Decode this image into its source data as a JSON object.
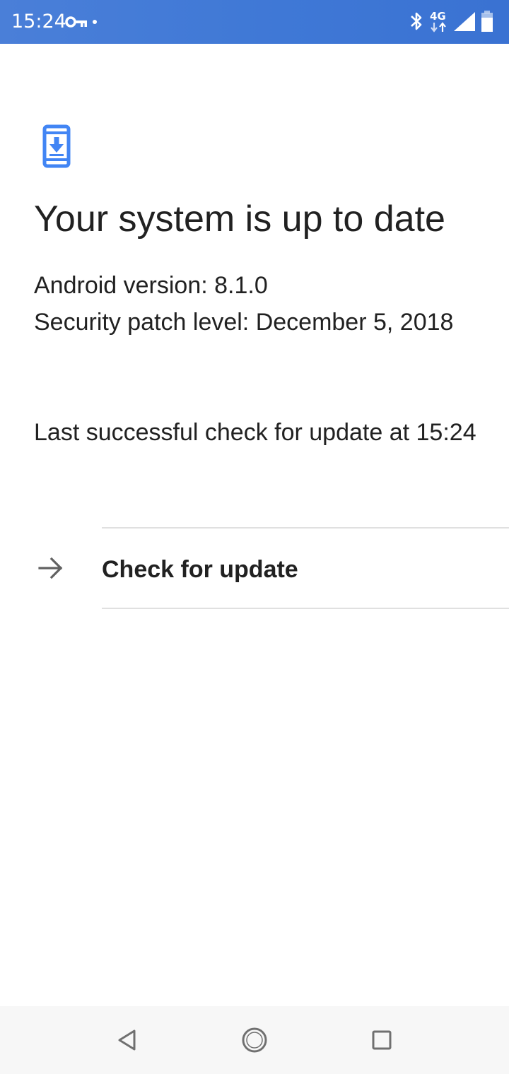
{
  "status_bar": {
    "time": "15:24",
    "network_type": "4G",
    "icons": [
      "vpn-key-icon",
      "notification-dot-icon",
      "bluetooth-icon",
      "network-4g-icon",
      "cell-signal-icon",
      "battery-icon"
    ]
  },
  "main": {
    "icon": "system-update-icon",
    "title": "Your system is up to date",
    "android_version": "Android version: 8.1.0",
    "security_patch": "Security patch level: December 5, 2018",
    "last_check": "Last successful check for update at 15:24",
    "check_button": {
      "icon": "arrow-forward-icon",
      "label": "Check for update"
    }
  },
  "nav_bar": {
    "buttons": [
      "back-icon",
      "home-icon",
      "recents-icon"
    ]
  },
  "colors": {
    "status_bar": "#4a7fd8",
    "accent": "#4285f4",
    "text": "#212121",
    "divider": "#e0e0e0",
    "nav_bar": "#f7f7f7",
    "nav_icon": "#707070"
  }
}
